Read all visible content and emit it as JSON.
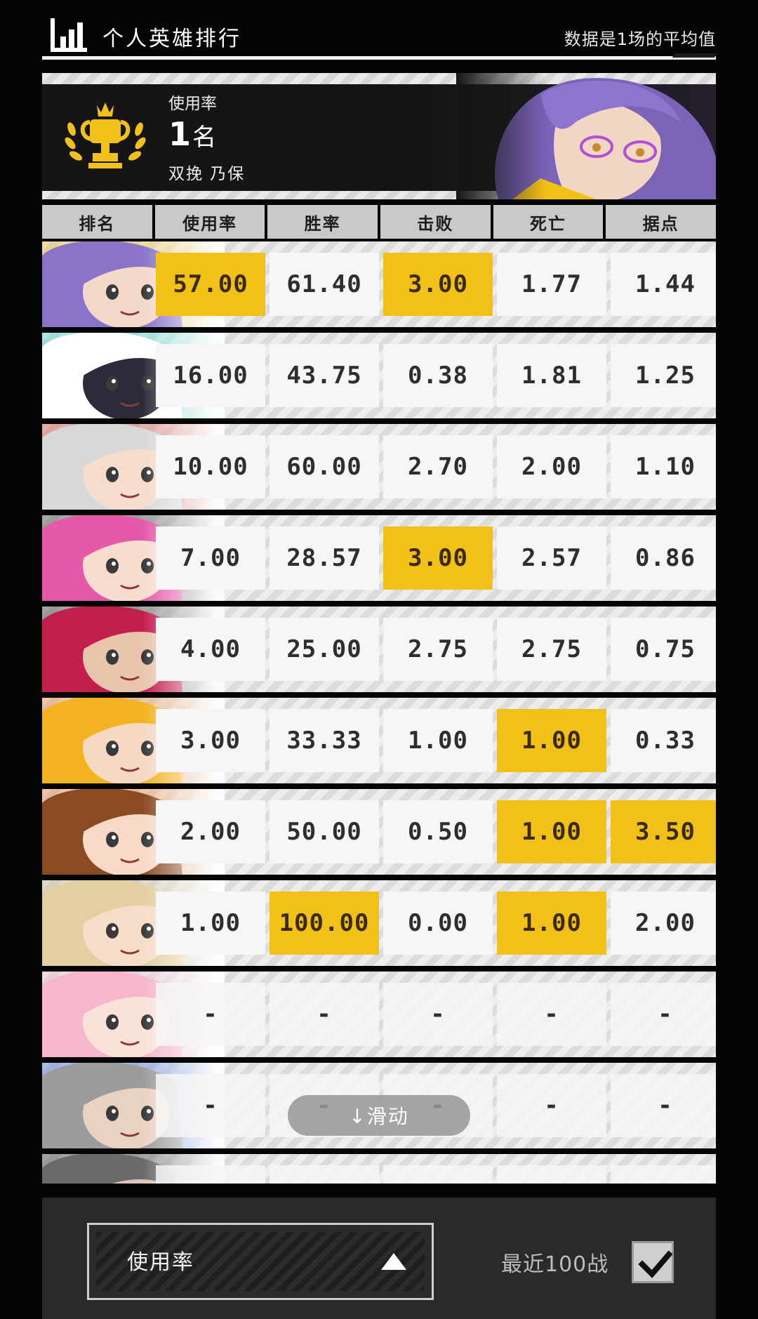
{
  "header": {
    "title": "个人英雄排行",
    "note": "数据是1场的平均值",
    "icon": "bar-chart-icon"
  },
  "banner": {
    "label": "使用率",
    "rank_number": "1",
    "rank_suffix": "名",
    "hero_name": "双挽 乃保",
    "icon": "trophy-icon"
  },
  "columns": [
    "排名",
    "使用率",
    "胜率",
    "击败",
    "死亡",
    "据点"
  ],
  "rows": [
    {
      "values": [
        "57.00",
        "61.40",
        "3.00",
        "1.77",
        "1.44"
      ],
      "highlight": [
        true,
        false,
        true,
        false,
        false
      ],
      "hair": "#8a73c9",
      "skin": "#f3d8c8",
      "accent": "#f2c118"
    },
    {
      "values": [
        "16.00",
        "43.75",
        "0.38",
        "1.81",
        "1.25"
      ],
      "highlight": [
        false,
        false,
        false,
        false,
        false
      ],
      "hair": "#ffffff",
      "skin": "#2b2b3a",
      "accent": "#37d9c9"
    },
    {
      "values": [
        "10.00",
        "60.00",
        "2.70",
        "2.00",
        "1.10"
      ],
      "highlight": [
        false,
        false,
        false,
        false,
        false
      ],
      "hair": "#d8d8d8",
      "skin": "#f5dccb",
      "accent": "#d43a2a"
    },
    {
      "values": [
        "7.00",
        "28.57",
        "3.00",
        "2.57",
        "0.86"
      ],
      "highlight": [
        false,
        false,
        true,
        false,
        false
      ],
      "hair": "#e45aa8",
      "skin": "#f7dcd0",
      "accent": "#222222"
    },
    {
      "values": [
        "4.00",
        "25.00",
        "2.75",
        "2.75",
        "0.75"
      ],
      "highlight": [
        false,
        false,
        false,
        false,
        false
      ],
      "hair": "#c21f4e",
      "skin": "#e9c5ad",
      "accent": "#1a1a1a"
    },
    {
      "values": [
        "3.00",
        "33.33",
        "1.00",
        "1.00",
        "0.33"
      ],
      "highlight": [
        false,
        false,
        false,
        true,
        false
      ],
      "hair": "#f3b321",
      "skin": "#f5d9c3",
      "accent": "#f07a2a"
    },
    {
      "values": [
        "2.00",
        "50.00",
        "0.50",
        "1.00",
        "3.50"
      ],
      "highlight": [
        false,
        false,
        false,
        true,
        true
      ],
      "hair": "#8a4a22",
      "skin": "#f7dac5",
      "accent": "#f07a2a"
    },
    {
      "values": [
        "1.00",
        "100.00",
        "0.00",
        "1.00",
        "2.00"
      ],
      "highlight": [
        false,
        true,
        false,
        true,
        false
      ],
      "hair": "#e3cf9f",
      "skin": "#f5ddc8",
      "accent": "#c9b48a"
    },
    {
      "values": [
        "-",
        "-",
        "-",
        "-",
        "-"
      ],
      "highlight": [
        false,
        false,
        false,
        false,
        false
      ],
      "hair": "#f6b6cc",
      "skin": "#fbe2d8",
      "accent": "#f6b6cc"
    },
    {
      "values": [
        "-",
        "-",
        "-",
        "-",
        "-"
      ],
      "highlight": [
        false,
        false,
        false,
        false,
        false
      ],
      "hair": "#9c9c9c",
      "skin": "#ead2c2",
      "accent": "#2a5bd4"
    },
    {
      "values": [
        "",
        "",
        "",
        "",
        ""
      ],
      "highlight": [
        false,
        false,
        false,
        false,
        false
      ],
      "hair": "#6a6a6a",
      "skin": "#d9c6bb",
      "accent": "#1a1a1a"
    }
  ],
  "scroll_hint": "↓滑动",
  "footer": {
    "select_value": "使用率",
    "recent_label": "最近100战",
    "recent_checked": true
  },
  "colors": {
    "highlight": "#f2c118",
    "cell": "#f6f6f6",
    "background": "#050505"
  }
}
